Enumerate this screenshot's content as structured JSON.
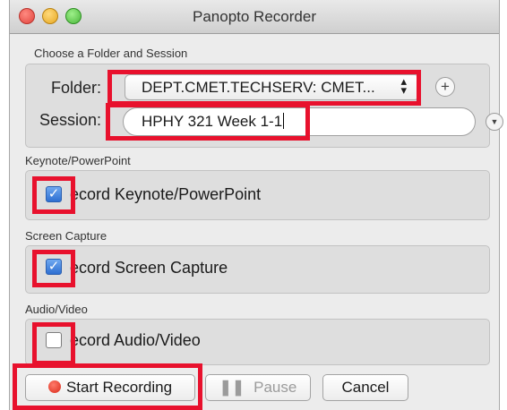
{
  "window": {
    "title": "Panopto Recorder"
  },
  "session_group": {
    "heading": "Choose a Folder and Session",
    "folder_label": "Folder:",
    "folder_value": "DEPT.CMET.TECHSERV: CMET...",
    "session_label": "Session:",
    "session_value": "HPHY 321 Week 1-1"
  },
  "keynote": {
    "heading": "Keynote/PowerPoint",
    "label": "ecord Keynote/PowerPoint",
    "checked": true
  },
  "screen": {
    "heading": "Screen Capture",
    "label": "ecord Screen Capture",
    "checked": true
  },
  "audio": {
    "heading": "Audio/Video",
    "label": "ecord Audio/Video",
    "checked": false
  },
  "buttons": {
    "start": "Start Recording",
    "pause": "Pause",
    "cancel": "Cancel"
  },
  "icons": {
    "folder_stepper": "up-down-arrows-icon",
    "add_folder": "plus-circle-icon",
    "session_dropdown": "chevron-down-circle-icon",
    "record": "record-dot-icon",
    "pause": "pause-icon"
  },
  "colors": {
    "highlight": "#e8112d",
    "record_dot": "#d92a1a",
    "checkbox_checked": "#2e6fd1"
  }
}
